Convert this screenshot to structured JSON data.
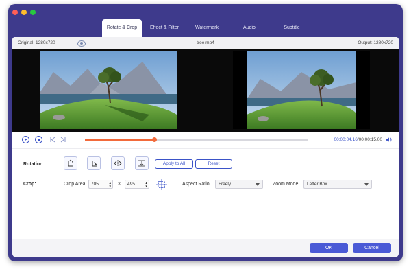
{
  "window": {
    "traffic_lights": [
      {
        "name": "close",
        "color": "#ff5f57"
      },
      {
        "name": "minimize",
        "color": "#febc2e"
      },
      {
        "name": "maximize",
        "color": "#28c840"
      }
    ]
  },
  "tabs": [
    {
      "label": "Rotate & Crop",
      "active": true
    },
    {
      "label": "Effect & Filter",
      "active": false
    },
    {
      "label": "Watermark",
      "active": false
    },
    {
      "label": "Audio",
      "active": false
    },
    {
      "label": "Subtitle",
      "active": false
    }
  ],
  "infobar": {
    "original": "Original: 1280x720",
    "filename": "tree.mp4",
    "output": "Output: 1280x720",
    "preview_icon": "eye-icon"
  },
  "playback": {
    "progress": 0.31,
    "current_time": "00:00:04.16",
    "total_time": "/00:00:15.00",
    "icons": [
      "play-icon",
      "stop-icon",
      "previous-frame-icon",
      "next-frame-icon",
      "volume-icon"
    ]
  },
  "rotation": {
    "label": "Rotation:",
    "buttons": [
      {
        "name": "rotate-left-button",
        "icon": "rotate-left-icon"
      },
      {
        "name": "rotate-right-button",
        "icon": "rotate-right-icon"
      },
      {
        "name": "flip-horizontal-button",
        "icon": "flip-horizontal-icon"
      },
      {
        "name": "flip-vertical-button",
        "icon": "flip-vertical-icon"
      }
    ],
    "apply_all": "Apply to All",
    "reset": "Reset"
  },
  "crop": {
    "label": "Crop:",
    "area_label": "Crop Area:",
    "width": "705",
    "times": "×",
    "height": "495",
    "center_icon": "crosshair-icon",
    "aspect_label": "Aspect Ratio:",
    "aspect_value": "Freely",
    "zoom_label": "Zoom Mode:",
    "zoom_value": "Letter Box"
  },
  "footer": {
    "ok": "OK",
    "cancel": "Cancel"
  },
  "colors": {
    "frame": "#3e3a8c",
    "accent": "#4a5ad6",
    "progress": "#f26a3b"
  }
}
